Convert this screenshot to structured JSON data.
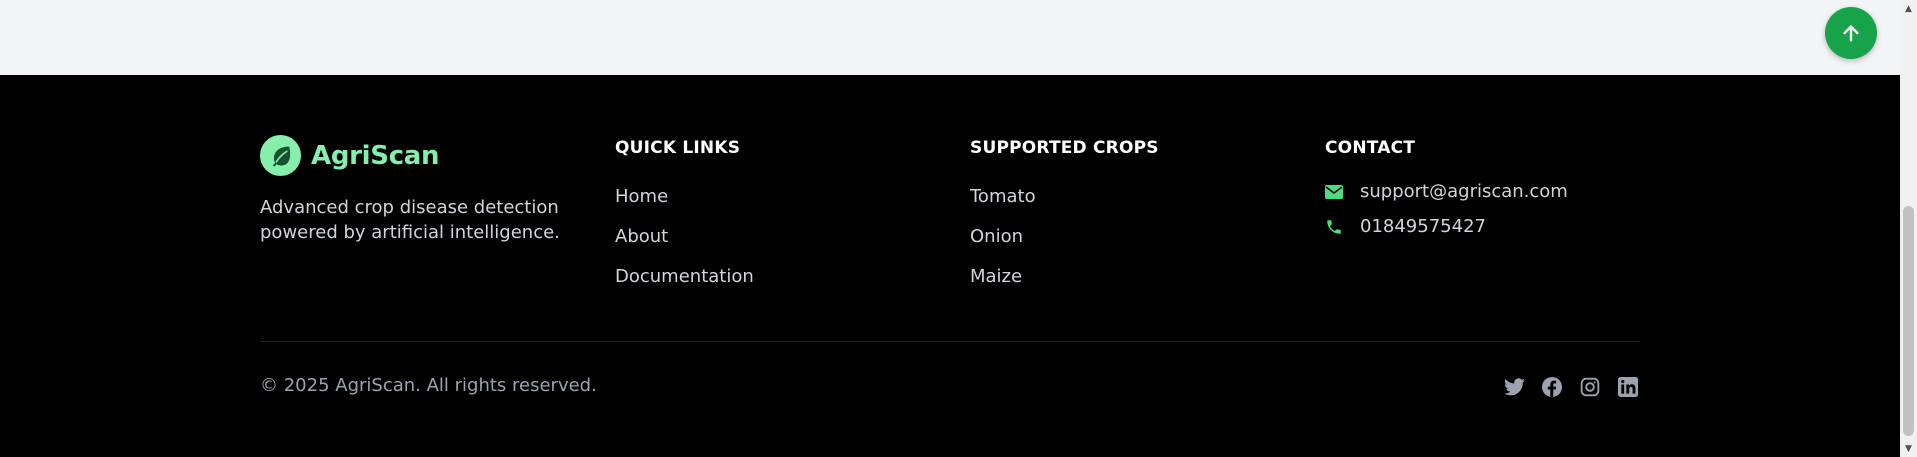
{
  "scroll_top": {
    "icon": "arrow-up-icon"
  },
  "brand": {
    "name": "AgriScan",
    "logo_icon": "leaf-icon",
    "description": "Advanced crop disease detection powered by artificial intelligence."
  },
  "quick_links": {
    "title": "QUICK LINKS",
    "items": [
      "Home",
      "About",
      "Documentation"
    ]
  },
  "supported_crops": {
    "title": "SUPPORTED CROPS",
    "items": [
      "Tomato",
      "Onion",
      "Maize"
    ]
  },
  "contact": {
    "title": "CONTACT",
    "email": "support@agriscan.com",
    "phone": "01849575427",
    "email_icon": "envelope-icon",
    "phone_icon": "phone-icon"
  },
  "copyright": "© 2025 AgriScan. All rights reserved.",
  "socials": [
    "twitter-icon",
    "facebook-icon",
    "instagram-icon",
    "linkedin-icon"
  ],
  "colors": {
    "accent": "#86efac",
    "button_green": "#16a34a",
    "contact_icon": "#4ade80",
    "footer_bg": "#000000",
    "top_bg": "#f3f4f6"
  }
}
